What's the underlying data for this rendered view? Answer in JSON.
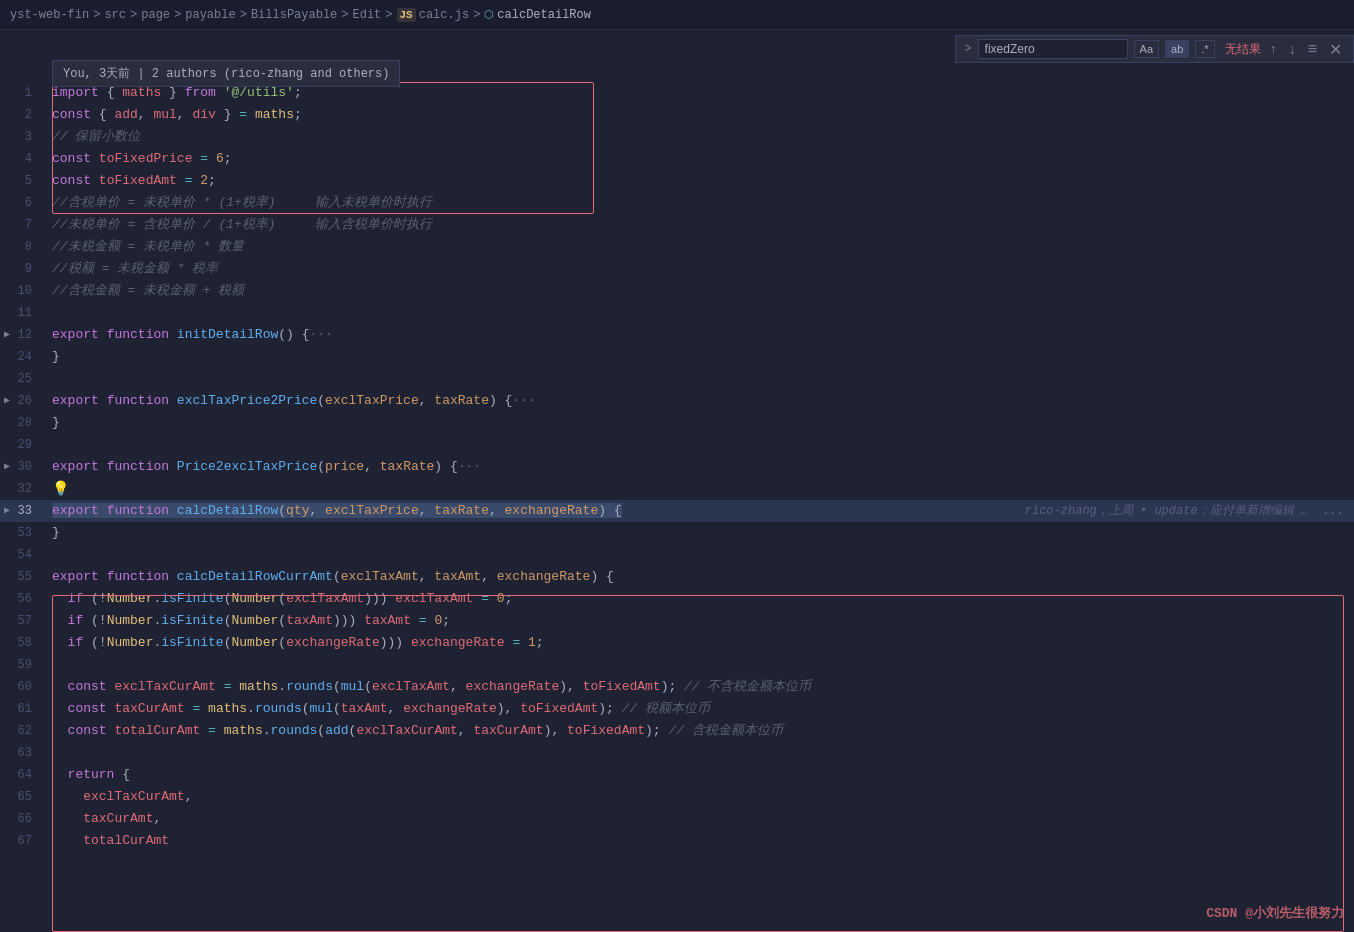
{
  "breadcrumb": {
    "parts": [
      "yst-web-fin",
      "src",
      "page",
      "payable",
      "BillsPayable",
      "Edit",
      "calc.js",
      "calcDetailRow"
    ],
    "separators": [
      ">",
      ">",
      ">",
      ">",
      ">",
      ">",
      ">"
    ]
  },
  "search": {
    "input_value": "fixedZero",
    "result_text": "无结果",
    "placeholder": "fixedZero",
    "btns": [
      "Aa",
      "ab",
      "*"
    ]
  },
  "author_tooltip": "You, 3天前 | 2 authors (rico-zhang and others)",
  "git_blame": "rico-zhang，上周 • update：应付单新增编辑 …  ...",
  "watermark": "CSDN @小刘先生很努力",
  "lines": [
    {
      "num": 1,
      "content": "import { maths } from '@/utils';",
      "type": "import"
    },
    {
      "num": 2,
      "content": "const { add, mul, div } = maths;",
      "type": "const"
    },
    {
      "num": 3,
      "content": "// 保留小数位",
      "type": "comment"
    },
    {
      "num": 4,
      "content": "const toFixedPrice = 6;",
      "type": "const"
    },
    {
      "num": 5,
      "content": "const toFixedAmt = 2;",
      "type": "const"
    },
    {
      "num": 6,
      "content": "//含税单价 = 未税单价 * (1+税率)     输入未税单价时执行",
      "type": "comment"
    },
    {
      "num": 7,
      "content": "//未税单价 = 含税单价 / (1+税率)     输入含税单价时执行",
      "type": "comment"
    },
    {
      "num": 8,
      "content": "//未税金额 = 未税单价 * 数量",
      "type": "comment"
    },
    {
      "num": 9,
      "content": "//税额 = 未税金额 * 税率",
      "type": "comment"
    },
    {
      "num": 10,
      "content": "//含税金额 = 未税金额 + 税额",
      "type": "comment"
    },
    {
      "num": 11,
      "content": "",
      "type": "empty"
    },
    {
      "num": 12,
      "content": "export function initDetailRow() {···",
      "type": "collapsed"
    },
    {
      "num": 24,
      "content": "}",
      "type": "close"
    },
    {
      "num": 25,
      "content": "",
      "type": "empty"
    },
    {
      "num": 26,
      "content": "export function exclTaxPrice2Price(exclTaxPrice, taxRate) {···",
      "type": "collapsed"
    },
    {
      "num": 28,
      "content": "}",
      "type": "close"
    },
    {
      "num": 29,
      "content": "",
      "type": "empty"
    },
    {
      "num": 30,
      "content": "export function Price2exclTaxPrice(price, taxRate) {···",
      "type": "collapsed"
    },
    {
      "num": 32,
      "content": "💡",
      "type": "lightbulb"
    },
    {
      "num": 33,
      "content": "export function calcDetailRow(qty, exclTaxPrice, taxRate, exchangeRate) {",
      "type": "cursor",
      "blame": true
    },
    {
      "num": 53,
      "content": "}",
      "type": "close"
    },
    {
      "num": 54,
      "content": "",
      "type": "empty"
    },
    {
      "num": 55,
      "content": "export function calcDetailRowCurrAmt(exclTaxAmt, taxAmt, exchangeRate) {",
      "type": "fn_open"
    },
    {
      "num": 56,
      "content": "  if (!Number.isFinite(Number(exclTaxAmt))) exclTaxAmt = 0;",
      "type": "code"
    },
    {
      "num": 57,
      "content": "  if (!Number.isFinite(Number(taxAmt))) taxAmt = 0;",
      "type": "code"
    },
    {
      "num": 58,
      "content": "  if (!Number.isFinite(Number(exchangeRate))) exchangeRate = 1;",
      "type": "code"
    },
    {
      "num": 59,
      "content": "",
      "type": "empty"
    },
    {
      "num": 60,
      "content": "  const exclTaxCurAmt = maths.rounds(mul(exclTaxAmt, exchangeRate), toFixedAmt); // 不含税金额本位币",
      "type": "code"
    },
    {
      "num": 61,
      "content": "  const taxCurAmt = maths.rounds(mul(taxAmt, exchangeRate), toFixedAmt); // 税额本位币",
      "type": "code"
    },
    {
      "num": 62,
      "content": "  const totalCurAmt = maths.rounds(add(exclTaxCurAmt, taxCurAmt), toFixedAmt); // 含税金额本位币",
      "type": "code"
    },
    {
      "num": 63,
      "content": "",
      "type": "empty"
    },
    {
      "num": 64,
      "content": "  return {",
      "type": "code"
    },
    {
      "num": 65,
      "content": "    exclTaxCurAmt,",
      "type": "code"
    },
    {
      "num": 66,
      "content": "    taxCurAmt,",
      "type": "code"
    },
    {
      "num": 67,
      "content": "    totalCurAmt",
      "type": "code"
    }
  ]
}
